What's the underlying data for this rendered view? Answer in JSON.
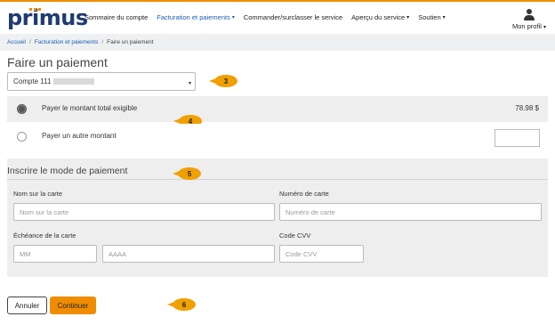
{
  "header": {
    "logo": "primus",
    "nav": [
      {
        "label": "Sommaire du compte",
        "has_caret": false,
        "active": false
      },
      {
        "label": "Facturation et paiements",
        "has_caret": true,
        "active": true
      },
      {
        "label": "Commander/surclasser le service",
        "has_caret": false,
        "active": false
      },
      {
        "label": "Aperçu du service",
        "has_caret": true,
        "active": false
      },
      {
        "label": "Soutien",
        "has_caret": true,
        "active": false
      }
    ],
    "profile_label": "Mon profil",
    "caret_glyph": "▾"
  },
  "breadcrumb": {
    "home": "Accueil",
    "section": "Facturation et paiements",
    "current": "Faire un paiement",
    "separator": "/"
  },
  "page_title": "Faire un paiement",
  "account_select": {
    "value_prefix": "Compte 111"
  },
  "payment_options": {
    "total_label": "Payer le montant total exigible",
    "total_amount": "78.98 $",
    "total_selected": true,
    "other_label": "Payer un autre montant",
    "other_selected": false
  },
  "payment_method": {
    "title": "Inscrire le mode de paiement",
    "card_name_label": "Nom sur la carte",
    "card_name_placeholder": "Nom sur la carte",
    "card_number_label": "Numéro de carte",
    "card_number_placeholder": "Numéro de carte",
    "expiry_label": "Échéance de la carte",
    "month_placeholder": "MM",
    "year_placeholder": "AAAA",
    "cvv_label": "Code CVV",
    "cvv_placeholder": "Code CVV"
  },
  "actions": {
    "cancel": "Annuler",
    "continue": "Continuer"
  },
  "callouts": [
    "3",
    "4",
    "5",
    "6"
  ],
  "colors": {
    "accent": "#f08c00",
    "link": "#1a5fb4",
    "panel": "#eeeeee"
  }
}
